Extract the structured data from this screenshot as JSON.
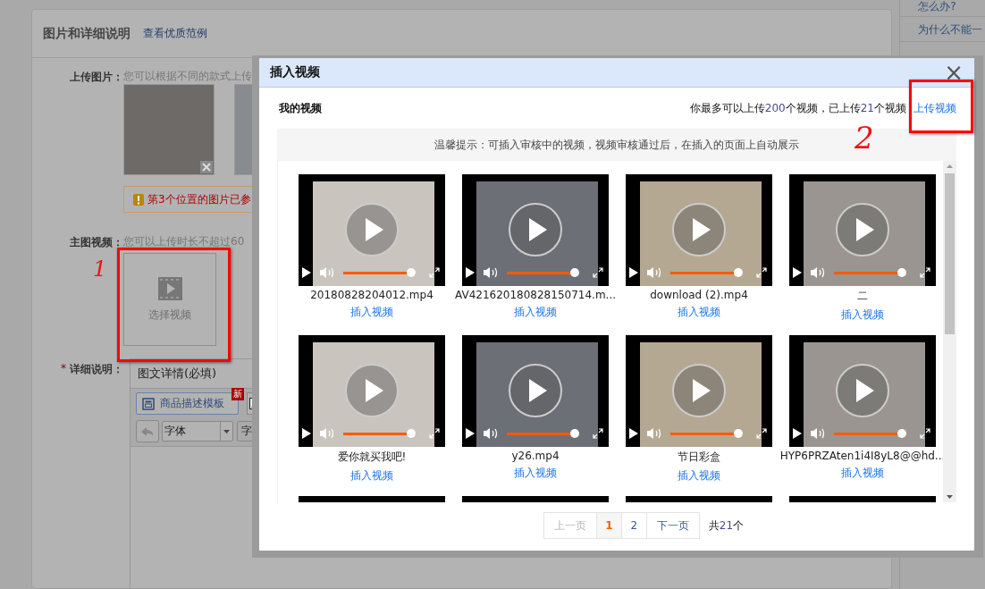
{
  "form": {
    "section_title": "图片和详细说明",
    "example_link": "查看优质范例",
    "upload_images": {
      "label": "上传图片：",
      "hint": "您可以根据不同的款式上传",
      "warning": "第3个位置的图片已参"
    },
    "main_video": {
      "label": "主图视频：",
      "hint": "您可以上传时长不超过60",
      "select_button": "选择视频",
      "annotation": "1"
    },
    "detail": {
      "label": "详细说明：",
      "required": true,
      "required_mark": "*",
      "tab": "图文详情(必填)",
      "template_button": "商品描述模板",
      "new_badge": "新",
      "font_select": "字体",
      "size_select": "字"
    }
  },
  "sidebar": {
    "links": [
      "怎么办?",
      "为什么不能一"
    ]
  },
  "dialog": {
    "title": "插入视频",
    "close": "×",
    "heading": "我的视频",
    "quota": [
      {
        "kind": "plain",
        "text": "你最多可以上传"
      },
      {
        "kind": "number",
        "text": "200"
      },
      {
        "kind": "plain",
        "text": "个视频，已上传"
      },
      {
        "kind": "number",
        "text": "21"
      },
      {
        "kind": "plain",
        "text": "个视频"
      }
    ],
    "upload_link": "上传视频",
    "upload_annotation": "2",
    "tip": "温馨提示：可插入审核中的视频，视频审核通过后，在插入的页面上自动展示",
    "videos": [
      {
        "kind": "full",
        "name": "20180828204012.mp4",
        "action": "插入视频",
        "level": 1
      },
      {
        "kind": "full",
        "name": "AV421620180828150714.m...",
        "action": "插入视频",
        "level": 1
      },
      {
        "kind": "full",
        "name": "download (2).mp4",
        "action": "插入视频",
        "level": 1
      },
      {
        "kind": "full",
        "name": "二",
        "action": "插入视频",
        "level": 1
      },
      {
        "kind": "full",
        "name": "爱你就买我吧!",
        "action": "插入视频",
        "level": 1
      },
      {
        "kind": "full",
        "name": "y26.mp4",
        "action": "插入视频",
        "level": 1
      },
      {
        "kind": "full",
        "name": "节日彩盒",
        "action": "插入视频",
        "level": 1
      },
      {
        "kind": "full",
        "name": "HYP6PRZAten1i4I8yL8@@hd...",
        "action": "插入视频",
        "level": 1
      },
      {
        "kind": "cut"
      },
      {
        "kind": "cut"
      },
      {
        "kind": "cut"
      },
      {
        "kind": "cut"
      }
    ],
    "pager": [
      {
        "label": "上一页",
        "kind": "prev",
        "disabled": true,
        "selected": false
      },
      {
        "label": "1",
        "kind": "page",
        "disabled": false,
        "selected": true
      },
      {
        "label": "2",
        "kind": "page",
        "disabled": false,
        "selected": false
      },
      {
        "label": "下一页",
        "kind": "next",
        "disabled": false,
        "selected": false
      }
    ],
    "total": [
      {
        "kind": "plain",
        "text": "共"
      },
      {
        "kind": "number",
        "text": "21"
      },
      {
        "kind": "plain",
        "text": "个"
      }
    ]
  }
}
